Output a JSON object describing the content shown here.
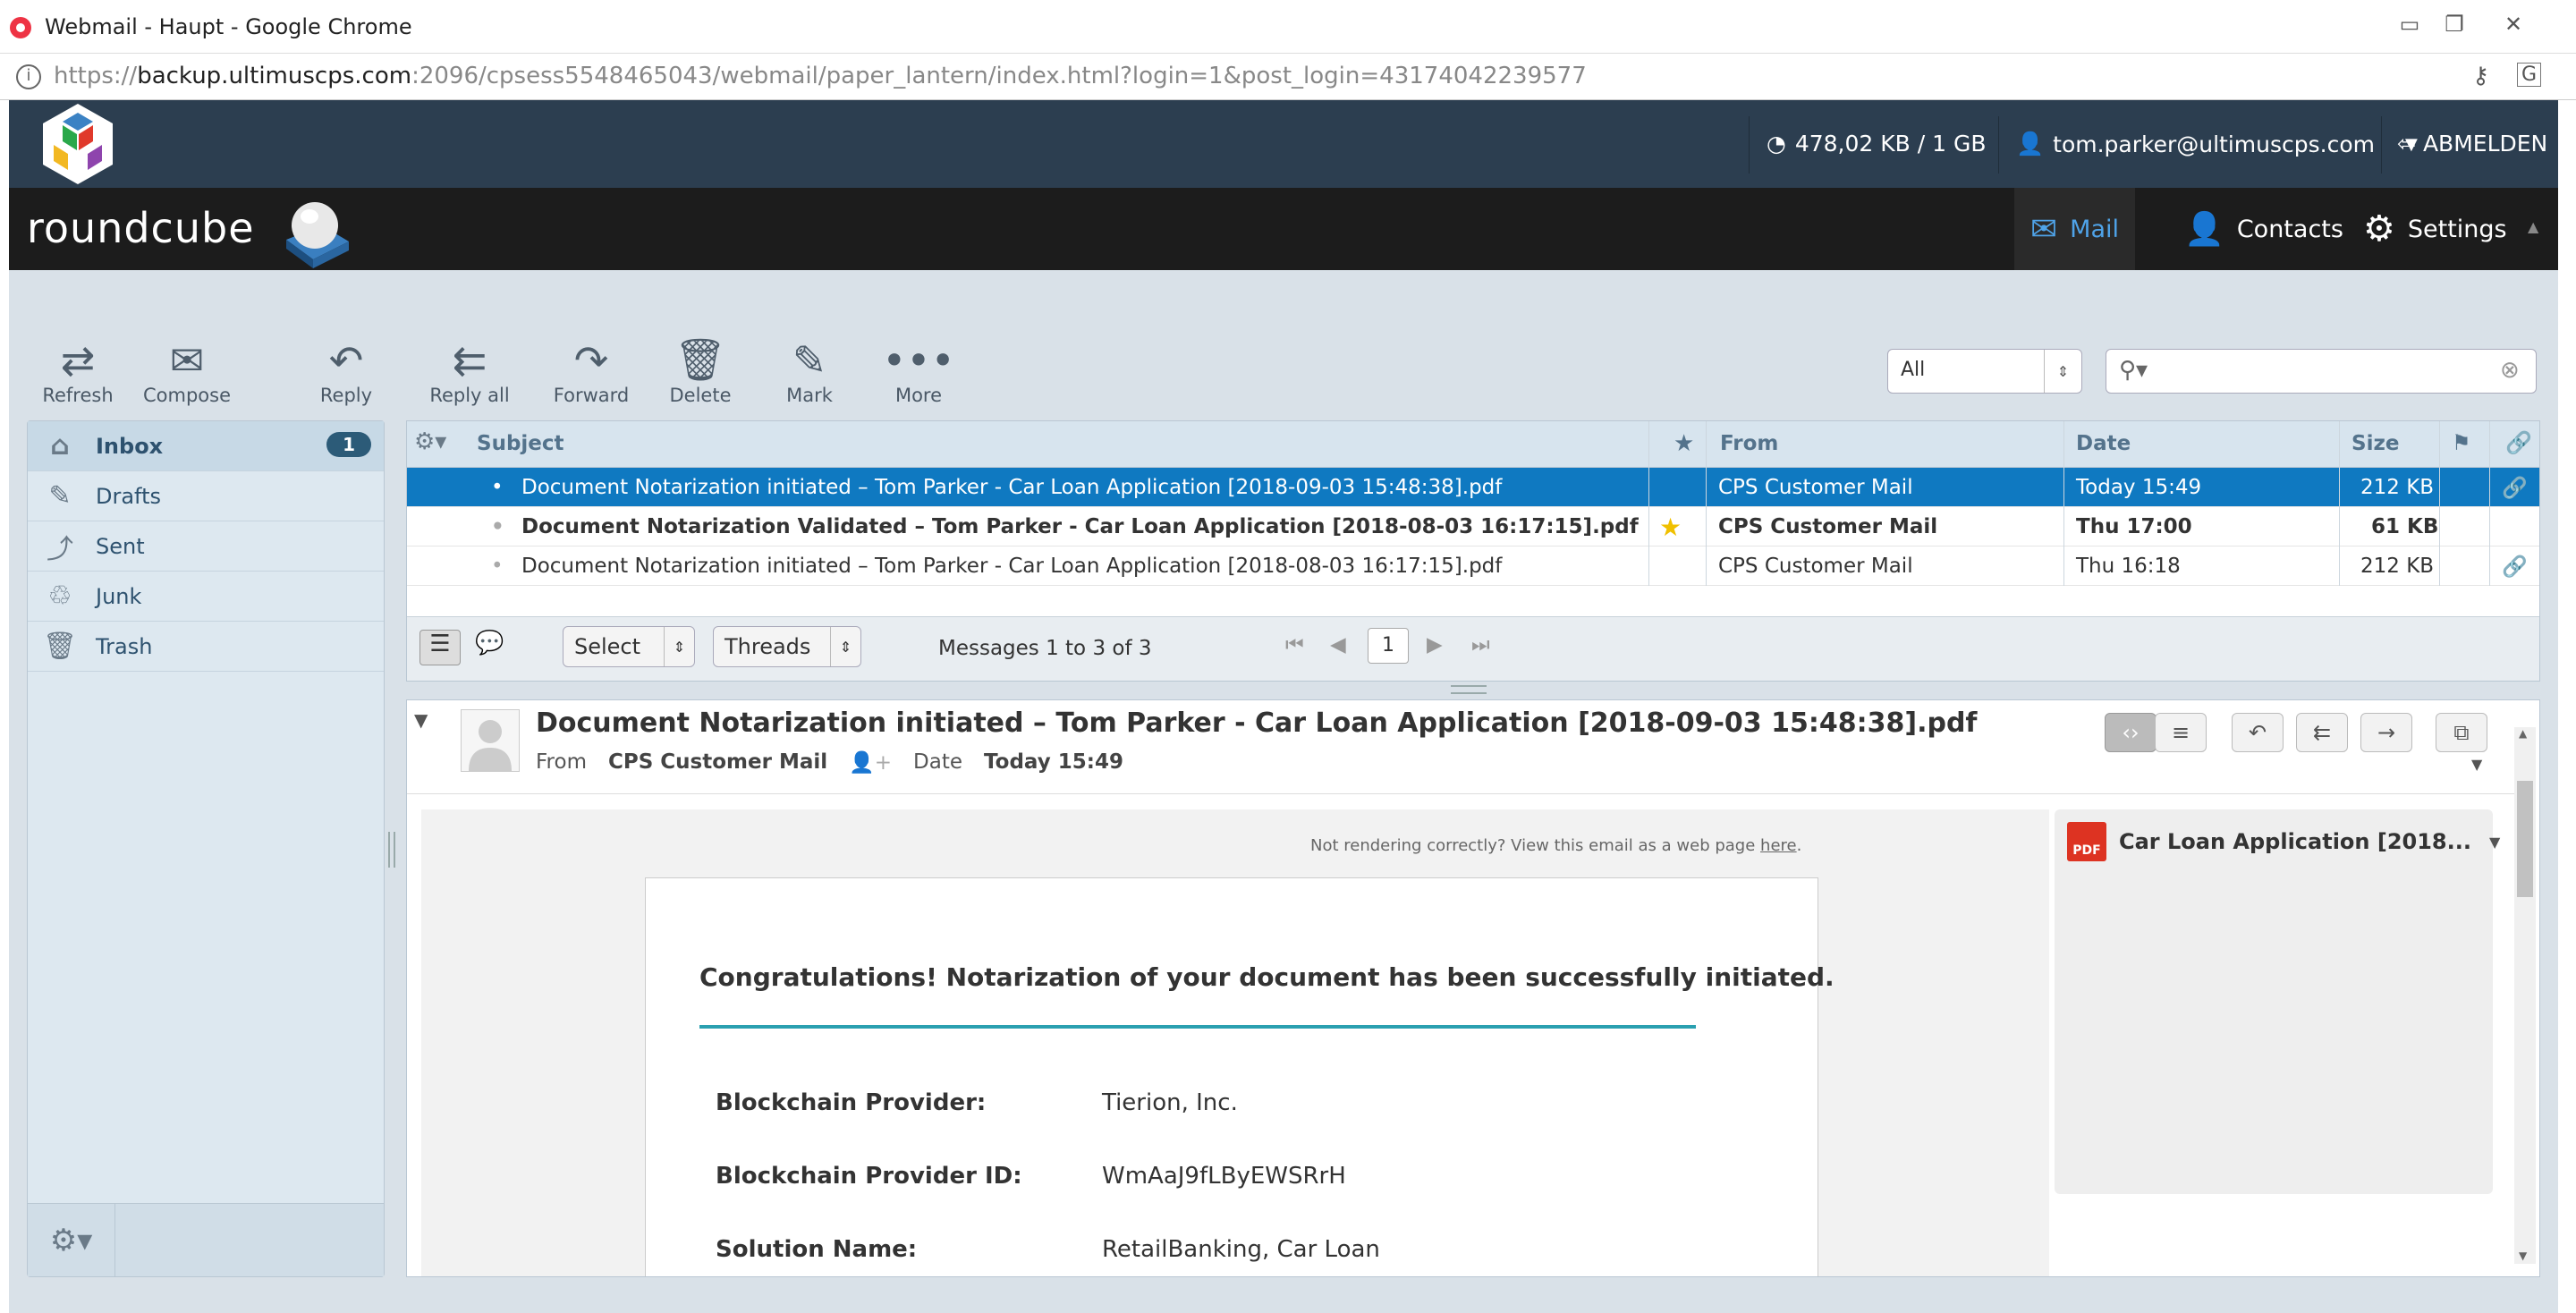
{
  "browser": {
    "title": "Webmail - Haupt - Google Chrome",
    "url_prefix": "https://",
    "url_host": "backup.ultimuscps.com",
    "url_rest": ":2096/cpsess5548465043/webmail/paper_lantern/index.html?login=1&post_login=43174042239577"
  },
  "cpanel": {
    "quota": "478,02 KB / 1 GB",
    "user": "tom.parker@ultimuscps.com",
    "logout": "ABMELDEN"
  },
  "roundcube": {
    "logo": "roundcube",
    "nav": [
      {
        "label": "Mail"
      },
      {
        "label": "Contacts"
      },
      {
        "label": "Settings"
      }
    ]
  },
  "toolbar": {
    "refresh": "Refresh",
    "compose": "Compose",
    "reply": "Reply",
    "reply_all": "Reply all",
    "forward": "Forward",
    "delete": "Delete",
    "mark": "Mark",
    "more": "More",
    "filter_value": "All"
  },
  "folders": [
    {
      "label": "Inbox",
      "count": "1"
    },
    {
      "label": "Drafts"
    },
    {
      "label": "Sent"
    },
    {
      "label": "Junk"
    },
    {
      "label": "Trash"
    }
  ],
  "list": {
    "columns": {
      "subject": "Subject",
      "from": "From",
      "date": "Date",
      "size": "Size"
    },
    "rows": [
      {
        "subject": "Document Notarization initiated – Tom Parker - Car Loan Application [2018-09-03 15:48:38].pdf",
        "from": "CPS Customer Mail",
        "date": "Today 15:49",
        "size": "212 KB"
      },
      {
        "subject": "Document Notarization Validated – Tom Parker - Car Loan Application [2018-08-03 16:17:15].pdf",
        "from": "CPS Customer Mail",
        "date": "Thu 17:00",
        "size": "61 KB"
      },
      {
        "subject": "Document Notarization initiated – Tom Parker - Car Loan Application [2018-08-03 16:17:15].pdf",
        "from": "CPS Customer Mail",
        "date": "Thu 16:18",
        "size": "212 KB"
      }
    ],
    "footer": {
      "select": "Select",
      "threads": "Threads",
      "count": "Messages 1 to 3 of 3",
      "page": "1"
    }
  },
  "preview": {
    "subject": "Document Notarization initiated – Tom Parker - Car Loan Application [2018-09-03 15:48:38].pdf",
    "from_label": "From",
    "from": "CPS Customer Mail",
    "date_label": "Date",
    "date": "Today 15:49",
    "notice": "Not rendering correctly? View this email as a web page",
    "notice_link": "here",
    "heading": "Congratulations! Notarization of your document has been successfully initiated.",
    "fields": [
      {
        "k": "Blockchain Provider:",
        "v": "Tierion, Inc."
      },
      {
        "k": "Blockchain Provider ID:",
        "v": "WmAaJ9fLByEWSRrH"
      },
      {
        "k": "Solution Name:",
        "v": "RetailBanking, Car Loan"
      }
    ],
    "attachment": "Car Loan Application [2018..."
  },
  "colors": {
    "accent": "#0f79c1",
    "header": "#2c3e50",
    "teal_line": "#2aa0b0"
  }
}
